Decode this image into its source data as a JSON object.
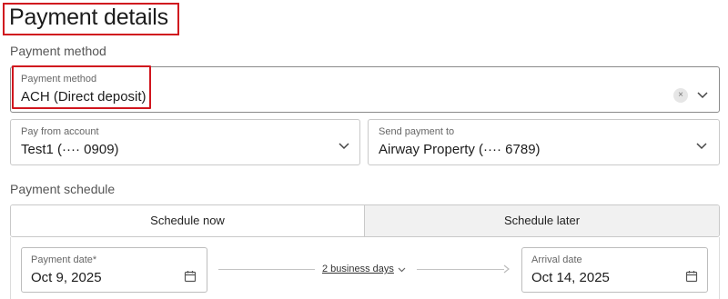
{
  "page": {
    "title": "Payment details"
  },
  "payment_method_section": {
    "label": "Payment method",
    "field": {
      "label": "Payment method",
      "value": "ACH (Direct deposit)",
      "clear_icon": "×"
    }
  },
  "pay_from": {
    "label": "Pay from account",
    "value": "Test1 (···· 0909)"
  },
  "send_to": {
    "label": "Send payment to",
    "value": "Airway Property (···· 6789)"
  },
  "schedule": {
    "label": "Payment schedule",
    "tabs": [
      {
        "label": "Schedule now",
        "selected": false
      },
      {
        "label": "Schedule later",
        "selected": true
      }
    ],
    "payment_date": {
      "label": "Payment date*",
      "value": "Oct 9, 2025"
    },
    "business_days": "2 business days",
    "arrival_date": {
      "label": "Arrival date",
      "value": "Oct 14, 2025"
    }
  },
  "colors": {
    "highlight": "#d0161e",
    "tab_selected_bg": "#f1f1f1",
    "border": "#c9c9c9"
  },
  "icons": [
    "clear-icon",
    "chevron-down-icon",
    "calendar-icon",
    "arrow-right-icon"
  ]
}
